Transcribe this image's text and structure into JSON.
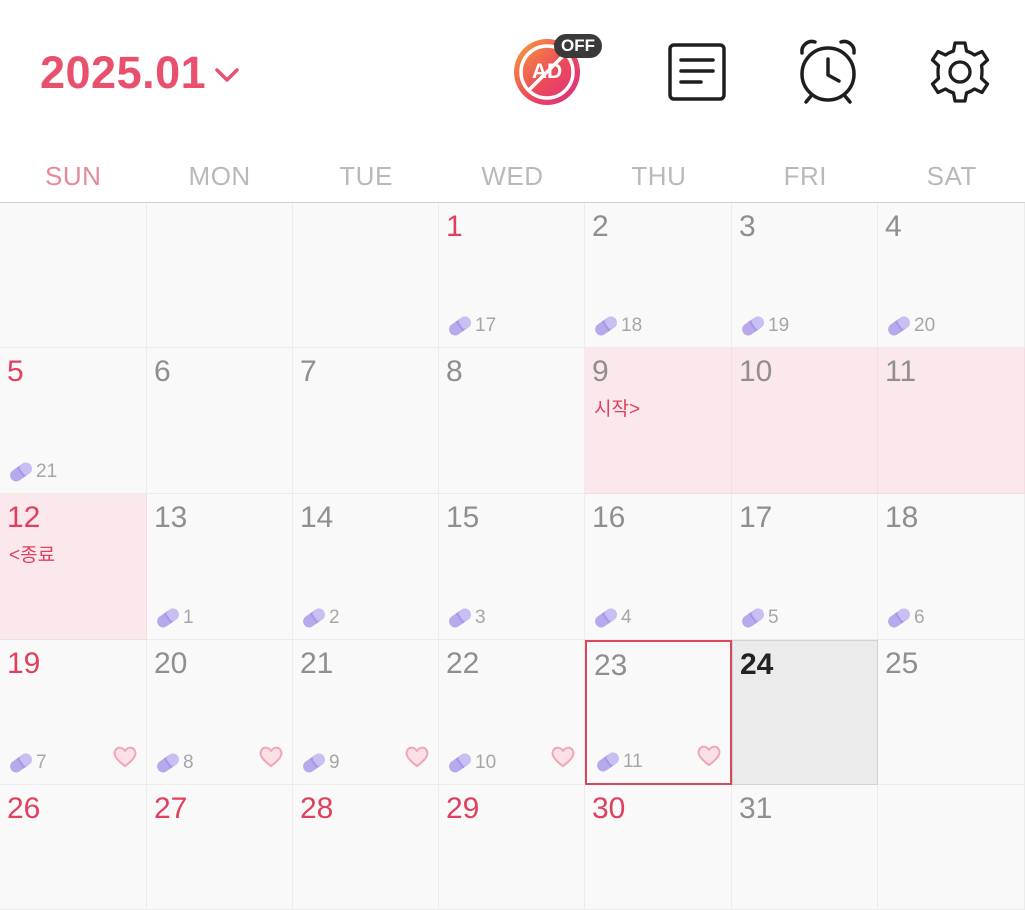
{
  "header": {
    "month_label": "2025.01",
    "ad_badge": "OFF",
    "ad_label": "AD"
  },
  "weekdays": [
    "SUN",
    "MON",
    "TUE",
    "WED",
    "THU",
    "FRI",
    "SAT"
  ],
  "colors": {
    "accent": "#e8506e",
    "period_bg": "#fbe8ec",
    "pill": "#b7a9ec",
    "heart": "#f2a6b4"
  },
  "icons": [
    "ad-toggle-icon",
    "chevron-down-icon",
    "note-list-icon",
    "alarm-clock-icon",
    "gear-icon",
    "pill-icon",
    "heart-icon"
  ],
  "calendar": {
    "days": [
      {
        "num": "",
        "red": false
      },
      {
        "num": "",
        "red": false
      },
      {
        "num": "",
        "red": false
      },
      {
        "num": "1",
        "red": true,
        "pill": "17"
      },
      {
        "num": "2",
        "pill": "18"
      },
      {
        "num": "3",
        "pill": "19"
      },
      {
        "num": "4",
        "pill": "20"
      },
      {
        "num": "5",
        "red": true,
        "pill": "21"
      },
      {
        "num": "6"
      },
      {
        "num": "7"
      },
      {
        "num": "8"
      },
      {
        "num": "9",
        "period": true,
        "note": "시작>"
      },
      {
        "num": "10",
        "period": true
      },
      {
        "num": "11",
        "period": true
      },
      {
        "num": "12",
        "red": true,
        "period": true,
        "note": "<종료"
      },
      {
        "num": "13",
        "pill": "1"
      },
      {
        "num": "14",
        "pill": "2"
      },
      {
        "num": "15",
        "pill": "3"
      },
      {
        "num": "16",
        "pill": "4"
      },
      {
        "num": "17",
        "pill": "5"
      },
      {
        "num": "18",
        "pill": "6"
      },
      {
        "num": "19",
        "red": true,
        "pill": "7",
        "heart": true
      },
      {
        "num": "20",
        "pill": "8",
        "heart": true
      },
      {
        "num": "21",
        "pill": "9",
        "heart": true
      },
      {
        "num": "22",
        "pill": "10",
        "heart": true
      },
      {
        "num": "23",
        "pill": "11",
        "heart": true,
        "selected": true
      },
      {
        "num": "24",
        "today": true
      },
      {
        "num": "25"
      },
      {
        "num": "26",
        "red": true
      },
      {
        "num": "27",
        "red": true
      },
      {
        "num": "28",
        "red": true
      },
      {
        "num": "29",
        "red": true
      },
      {
        "num": "30",
        "red": true
      },
      {
        "num": "31"
      },
      {
        "num": ""
      }
    ]
  }
}
